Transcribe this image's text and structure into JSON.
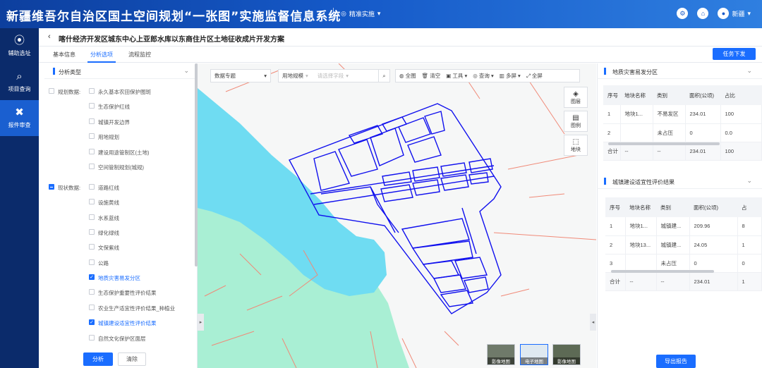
{
  "app": {
    "title": "新疆维吾尔自治区国土空间规划“一张图”实施监督信息系统",
    "mode_label": "精准实施",
    "user": "新疆"
  },
  "nav": [
    {
      "label": "辅助选址",
      "icon": "location-icon"
    },
    {
      "label": "项目查询",
      "icon": "search-doc-icon"
    },
    {
      "label": "报件审查",
      "icon": "tools-icon"
    }
  ],
  "page": {
    "back": "‹",
    "title": "喀什经济开发区城东中心上亚郎水库以东商住片区土地征收成片开发方案"
  },
  "tabs": [
    "基本信息",
    "分析选项",
    "流程监控"
  ],
  "task_button": "任务下发",
  "analysis": {
    "header": "分析类型",
    "groups": [
      {
        "label": "规划数据:",
        "checked": false,
        "items": [
          {
            "label": "永久基本农田保护图斑",
            "checked": false
          },
          {
            "label": "生态保护红线",
            "checked": false
          },
          {
            "label": "城镇开发边界",
            "checked": false
          },
          {
            "label": "用地规划",
            "checked": false
          },
          {
            "label": "建设用途管制区(土地)",
            "checked": false
          },
          {
            "label": "空间管制规划(城规)",
            "checked": false
          }
        ]
      },
      {
        "label": "现状数据:",
        "checked": "partial",
        "items": [
          {
            "label": "道路红线",
            "checked": false
          },
          {
            "label": "设施黄线",
            "checked": false
          },
          {
            "label": "水系蓝线",
            "checked": false
          },
          {
            "label": "绿化绿线",
            "checked": false
          },
          {
            "label": "文保紫线",
            "checked": false
          },
          {
            "label": "公路",
            "checked": false
          },
          {
            "label": "地质灾害易发分区",
            "checked": true
          },
          {
            "label": "生态保护重要性评价结果",
            "checked": false
          },
          {
            "label": "农业生产适宜性评价结果_种植业",
            "checked": false
          },
          {
            "label": "城镇建设适宜性评价结果",
            "checked": true
          },
          {
            "label": "自然文化保护区面层",
            "checked": false
          }
        ]
      }
    ],
    "analyze_button": "分析",
    "clear_button": "清除"
  },
  "map_toolbar": {
    "topic": "数据专题",
    "land_label": "用地规模",
    "field_placeholder": "请选择字段",
    "fullview": "全图",
    "clear": "清空",
    "tools": "工具",
    "query": "查询",
    "multiscreen": "多屏",
    "fullscreen": "全屏"
  },
  "map_controls": [
    "图层",
    "图例",
    "地块"
  ],
  "basemaps": [
    "影像地图",
    "电子地图",
    "影像地图"
  ],
  "table1": {
    "title": "地质灾害易发分区",
    "headers": [
      "序号",
      "地块名称",
      "类别",
      "面积(公顷)",
      "占比"
    ],
    "rows": [
      [
        "1",
        "地块1...",
        "不易发区",
        "234.01",
        "100"
      ],
      [
        "2",
        "",
        "未占压",
        "0",
        "0.0"
      ]
    ],
    "total": [
      "合计",
      "--",
      "--",
      "234.01",
      "100"
    ]
  },
  "table2": {
    "title": "城镇建设适宜性评价结果",
    "headers": [
      "序号",
      "地块名称",
      "类别",
      "面积(公顷)",
      "占"
    ],
    "rows": [
      [
        "1",
        "地块1...",
        "城镇建...",
        "209.96",
        "8"
      ],
      [
        "2",
        "地块13...",
        "城镇建...",
        "24.05",
        "1"
      ],
      [
        "3",
        "",
        "未占压",
        "0",
        "0"
      ]
    ],
    "total": [
      "合计",
      "--",
      "--",
      "234.01",
      "1"
    ]
  },
  "export_button": "导出报告",
  "colors": {
    "accent": "#1a6dff",
    "nav_bg": "#0b2b6b",
    "parcel": "#1010ee",
    "water": "#6fdcf2",
    "green": "#a9efd4"
  }
}
